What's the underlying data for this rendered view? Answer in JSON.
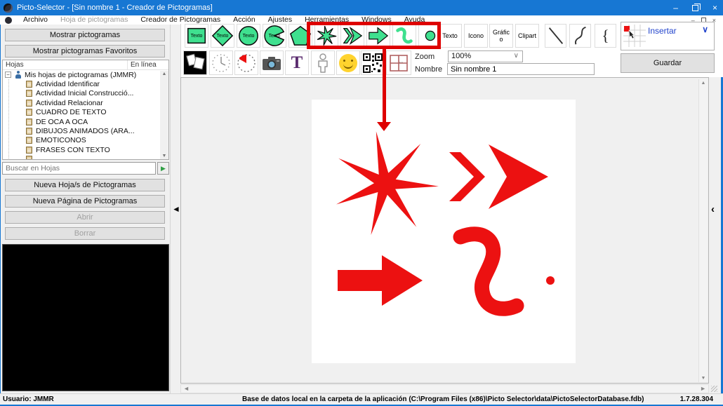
{
  "window": {
    "title": "Picto-Selector - [Sin nombre 1 - Creador de Pictogramas]"
  },
  "menu": {
    "items": [
      {
        "label": "Archivo"
      },
      {
        "label": "Hoja de pictogramas"
      },
      {
        "label": "Creador de Pictogramas"
      },
      {
        "label": "Acción"
      },
      {
        "label": "Ajustes"
      },
      {
        "label": "Herramientas"
      },
      {
        "label": "Windows"
      },
      {
        "label": "Ayuda"
      }
    ]
  },
  "sidebar": {
    "show_pictograms": "Mostrar pictogramas",
    "show_favorites": "Mostrar pictogramas Favoritos",
    "tree": {
      "header_left": "Hojas",
      "header_right": "En línea",
      "root": "Mis hojas de pictogramas (JMMR)",
      "items": [
        "Actividad Identificar",
        "Actividad Inicial Construcció...",
        "Actividad Relacionar",
        "CUADRO DE TEXTO",
        "DE OCA A OCA",
        "DIBUJOS ANIMADOS (ARA...",
        "EMOTICONOS",
        "FRASES CON TEXTO"
      ]
    },
    "search_placeholder": "Buscar en Hojas",
    "new_sheet": "Nueva Hoja/s de Pictogramas",
    "new_page": "Nueva Página de Pictogramas",
    "open": "Abrir",
    "delete": "Borrar"
  },
  "toolbar": {
    "shape_label": "Texto",
    "insert_buttons": [
      "Texto",
      "Icono",
      "Gráfico",
      "Clipart"
    ],
    "fields": {
      "zoom_label": "Zoom",
      "zoom_value": "100%",
      "name_label": "Nombre",
      "name_value": "Sin nombre 1"
    },
    "insert_label": "Insertar",
    "save_label": "Guardar"
  },
  "statusbar": {
    "user": "Usuario: JMMR",
    "database": "Base de datos local en la carpeta de la aplicación (C:\\Program Files (x86)\\Picto Selector\\data\\PictoSelectorDatabase.fdb)",
    "version": "1.7.28.304"
  },
  "icons": {
    "minimize": "–",
    "close": "×",
    "scroll_up": "▲",
    "scroll_down": "▼",
    "scroll_left": "◄",
    "scroll_right": "►",
    "collapse_left": "◄",
    "collapse_right": "‹",
    "dropdown_chevron": "∨",
    "insert_chevron": "∨",
    "search_go": "▶",
    "tree_expander": "−",
    "brace": "{"
  },
  "colors": {
    "titlebar": "#1777D3",
    "accent_green": "#3FE08F",
    "canvas_red": "#EC1111",
    "annotation_red": "#DE0000",
    "smiley_yellow": "#FFD32E",
    "insert_blue": "#2244CC",
    "letter_t_purple": "#5B2C6F",
    "table_icon_red": "#B06060"
  }
}
